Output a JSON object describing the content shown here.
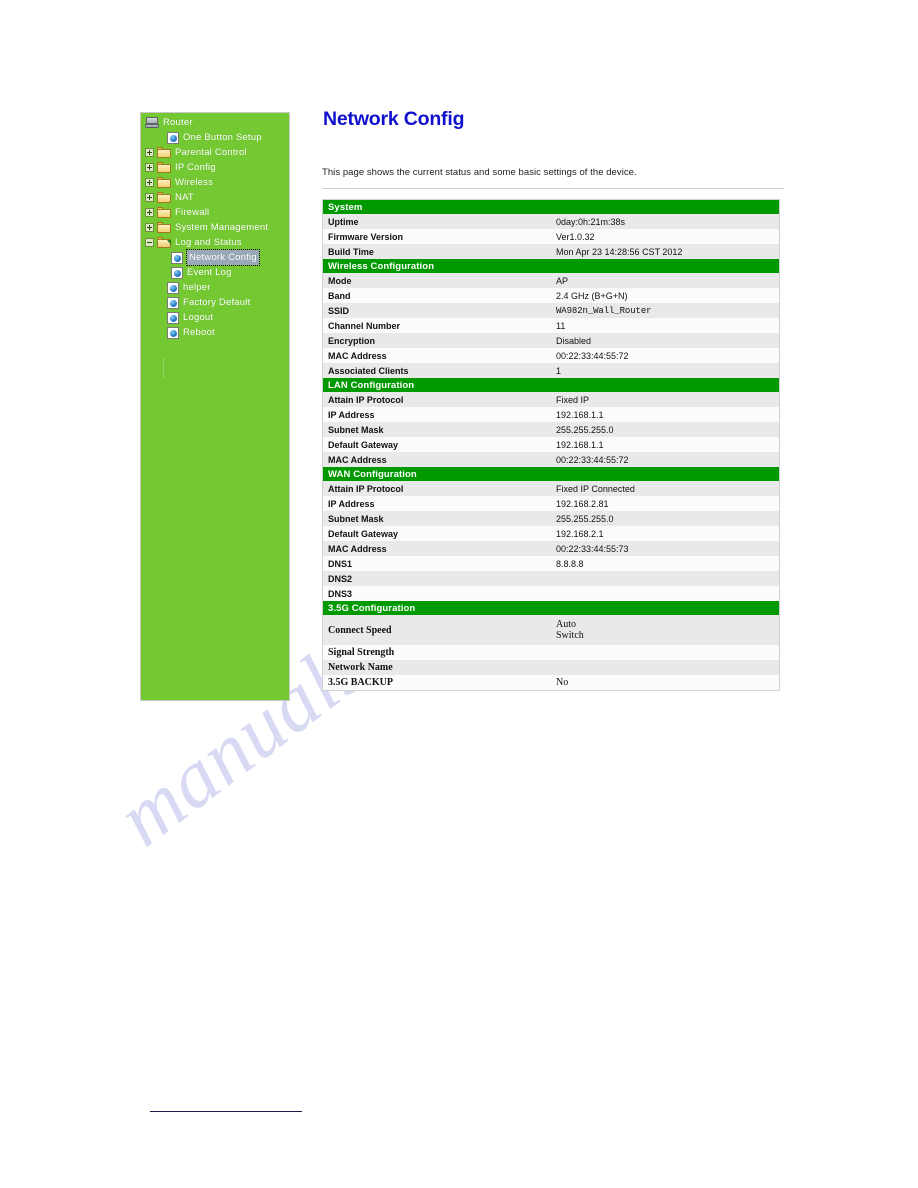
{
  "watermark": {
    "text": "manualshive.com"
  },
  "sidebar": {
    "root": {
      "label": "Router",
      "icon": "computer-icon"
    },
    "items": [
      {
        "label": "One Button Setup",
        "type": "leaf",
        "icon": "page-globe-icon",
        "level": 1
      },
      {
        "label": "Parental Control",
        "type": "folder",
        "icon": "folder-icon",
        "expander": "plus",
        "level": 1
      },
      {
        "label": "IP Config",
        "type": "folder",
        "icon": "folder-icon",
        "expander": "plus",
        "level": 1
      },
      {
        "label": "Wireless",
        "type": "folder",
        "icon": "folder-icon",
        "expander": "plus",
        "level": 1
      },
      {
        "label": "NAT",
        "type": "folder",
        "icon": "folder-icon",
        "expander": "plus",
        "level": 1
      },
      {
        "label": "Firewall",
        "type": "folder",
        "icon": "folder-icon",
        "expander": "plus",
        "level": 1
      },
      {
        "label": "System Management",
        "type": "folder",
        "icon": "folder-icon",
        "expander": "plus",
        "level": 1
      },
      {
        "label": "Log and Status",
        "type": "folder-open",
        "icon": "folder-open-icon",
        "expander": "minus",
        "level": 1
      },
      {
        "label": "Network Config",
        "type": "leaf",
        "icon": "page-globe-icon",
        "level": 2,
        "selected": true
      },
      {
        "label": "Event Log",
        "type": "leaf",
        "icon": "page-globe-icon",
        "level": 2
      },
      {
        "label": "helper",
        "type": "leaf",
        "icon": "page-globe-icon",
        "level": 1
      },
      {
        "label": "Factory Default",
        "type": "leaf",
        "icon": "page-globe-icon",
        "level": 1
      },
      {
        "label": "Logout",
        "type": "leaf",
        "icon": "page-globe-icon",
        "level": 1
      },
      {
        "label": "Reboot",
        "type": "leaf",
        "icon": "page-globe-icon",
        "level": 1
      }
    ]
  },
  "main": {
    "title": "Network Config",
    "description": "This page shows the current status and some basic settings of the device.",
    "sections": [
      {
        "heading": "System",
        "rows": [
          {
            "key": "Uptime",
            "value": "0day:0h:21m:38s"
          },
          {
            "key": "Firmware Version",
            "value": "Ver1.0.32"
          },
          {
            "key": "Build Time",
            "value": "Mon Apr 23 14:28:56 CST 2012"
          }
        ]
      },
      {
        "heading": "Wireless Configuration",
        "rows": [
          {
            "key": "Mode",
            "value": "AP"
          },
          {
            "key": "Band",
            "value": "2.4 GHz (B+G+N)"
          },
          {
            "key": "SSID",
            "value": "WA982n_Wall_Router",
            "mono": true
          },
          {
            "key": "Channel Number",
            "value": "11"
          },
          {
            "key": "Encryption",
            "value": "Disabled"
          },
          {
            "key": "MAC Address",
            "value": "00:22:33:44:55:72"
          },
          {
            "key": "Associated Clients",
            "value": "1"
          }
        ]
      },
      {
        "heading": "LAN Configuration",
        "rows": [
          {
            "key": "Attain IP Protocol",
            "value": "Fixed IP"
          },
          {
            "key": "IP Address",
            "value": "192.168.1.1"
          },
          {
            "key": "Subnet Mask",
            "value": "255.255.255.0"
          },
          {
            "key": "Default Gateway",
            "value": "192.168.1.1"
          },
          {
            "key": "MAC Address",
            "value": "00:22:33:44:55:72"
          }
        ]
      },
      {
        "heading": "WAN Configuration",
        "rows": [
          {
            "key": "Attain IP Protocol",
            "value": "Fixed IP Connected"
          },
          {
            "key": "IP Address",
            "value": "192.168.2.81"
          },
          {
            "key": "Subnet Mask",
            "value": "255.255.255.0"
          },
          {
            "key": "Default Gateway",
            "value": "192.168.2.1"
          },
          {
            "key": "MAC Address",
            "value": "00:22:33:44:55:73"
          },
          {
            "key": "DNS1",
            "value": "8.8.8.8"
          },
          {
            "key": "DNS2",
            "value": ""
          },
          {
            "key": "DNS3",
            "value": ""
          }
        ]
      },
      {
        "heading": "3.5G Configuration",
        "serif": true,
        "rows": [
          {
            "key": "Connect Speed",
            "value": "Auto\nSwitch",
            "tall": true
          },
          {
            "key": "Signal Strength",
            "value": ""
          },
          {
            "key": "Network Name",
            "value": ""
          },
          {
            "key": "3.5G BACKUP",
            "value": "No"
          }
        ]
      }
    ]
  }
}
